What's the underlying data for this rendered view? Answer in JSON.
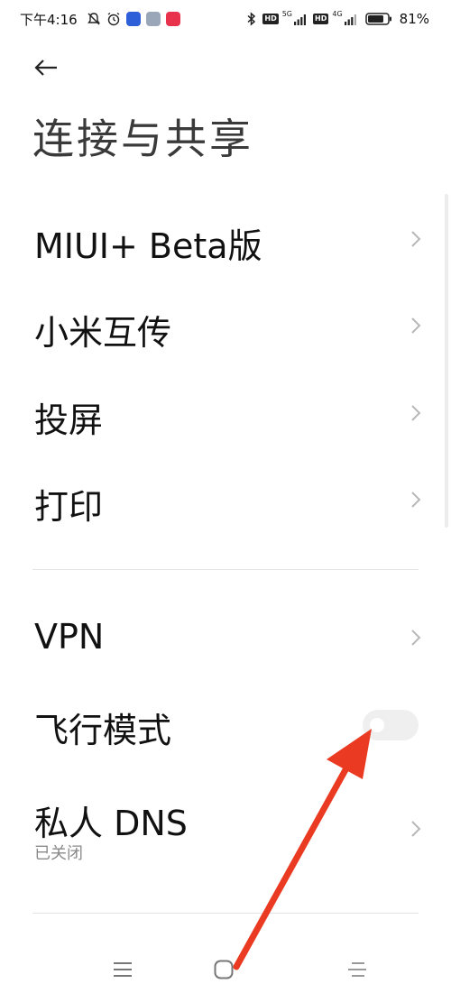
{
  "status_bar": {
    "time": "下午4:16",
    "net_5g": "5G",
    "net_4g": "4G",
    "hd1": "HD",
    "hd2": "HD",
    "battery_percent": "81%"
  },
  "header": {
    "title": "连接与共享"
  },
  "sections": [
    {
      "items": [
        {
          "label": "MIUI+ Beta版",
          "type": "link"
        },
        {
          "label": "小米互传",
          "type": "link"
        },
        {
          "label": "投屏",
          "type": "link"
        },
        {
          "label": "打印",
          "type": "link"
        }
      ]
    },
    {
      "items": [
        {
          "label": "VPN",
          "type": "link"
        },
        {
          "label": "飞行模式",
          "type": "toggle",
          "toggle_state": "off"
        },
        {
          "label": "私人 DNS",
          "sublabel": "已关闭",
          "type": "link"
        }
      ]
    }
  ],
  "icons": {
    "back": "arrow-left-icon",
    "chevron": "chevron-right-icon",
    "bluetooth": "bluetooth-icon",
    "battery": "battery-icon",
    "nav_menu": "menu-icon",
    "nav_home": "home-icon",
    "nav_back": "back-icon"
  },
  "colors": {
    "annotation_arrow": "#ea3a22",
    "toggle_off": "#efefef"
  }
}
